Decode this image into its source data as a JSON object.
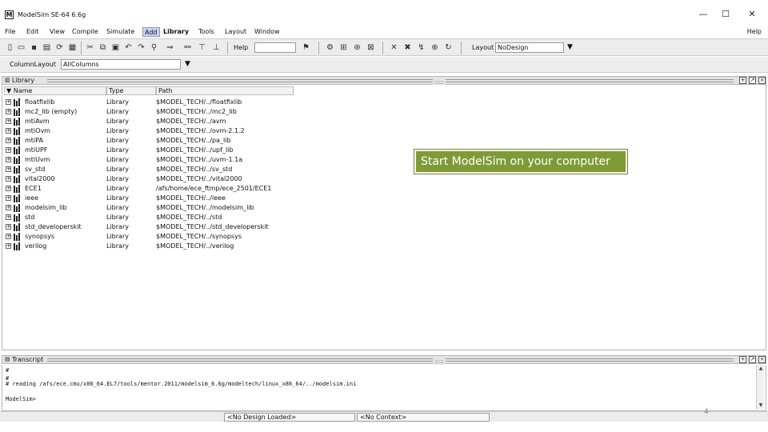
{
  "window": {
    "title": "ModelSim SE-64 6.6g",
    "app_icon": "M",
    "controls": {
      "minimize": "—",
      "maximize": "☐",
      "close": "✕"
    }
  },
  "menu": {
    "items": [
      "File",
      "Edit",
      "View",
      "Compile",
      "Simulate",
      "Add",
      "Library",
      "Tools",
      "Layout",
      "Window"
    ],
    "active": "Library",
    "help": "Help"
  },
  "toolbar": {
    "help_label": "Help",
    "help_value": "",
    "layout_label": "Layout",
    "layout_value": "NoDesign"
  },
  "toolbar2": {
    "column_layout_label": "ColumnLayout",
    "column_layout_value": "AllColumns"
  },
  "library_pane": {
    "title": "Library",
    "columns": {
      "name": "Name",
      "type": "Type",
      "path": "Path"
    },
    "rows": [
      {
        "name": "floatfixlib",
        "type": "Library",
        "path": "$MODEL_TECH/../floatfixlib"
      },
      {
        "name": "mc2_lib (empty)",
        "type": "Library",
        "path": "$MODEL_TECH/../mc2_lib"
      },
      {
        "name": "mtiAvm",
        "type": "Library",
        "path": "$MODEL_TECH/../avm"
      },
      {
        "name": "mtiOvm",
        "type": "Library",
        "path": "$MODEL_TECH/../ovm-2.1.2"
      },
      {
        "name": "mtiPA",
        "type": "Library",
        "path": "$MODEL_TECH/../pa_lib"
      },
      {
        "name": "mtiUPF",
        "type": "Library",
        "path": "$MODEL_TECH/../upf_lib"
      },
      {
        "name": "mtiUvm",
        "type": "Library",
        "path": "$MODEL_TECH/../uvm-1.1a"
      },
      {
        "name": "sv_std",
        "type": "Library",
        "path": "$MODEL_TECH/../sv_std"
      },
      {
        "name": "vital2000",
        "type": "Library",
        "path": "$MODEL_TECH/../vital2000"
      },
      {
        "name": "ECE1",
        "type": "Library",
        "path": "/afs/home/ece_ftmp/ece_2501/ECE1"
      },
      {
        "name": "ieee",
        "type": "Library",
        "path": "$MODEL_TECH/../ieee"
      },
      {
        "name": "modelsim_lib",
        "type": "Library",
        "path": "$MODEL_TECH/../modelsim_lib"
      },
      {
        "name": "std",
        "type": "Library",
        "path": "$MODEL_TECH/../std"
      },
      {
        "name": "std_developerskit",
        "type": "Library",
        "path": "$MODEL_TECH/../std_developerskit"
      },
      {
        "name": "synopsys",
        "type": "Library",
        "path": "$MODEL_TECH/../synopsys"
      },
      {
        "name": "verilog",
        "type": "Library",
        "path": "$MODEL_TECH/../verilog"
      }
    ]
  },
  "callout": "Start ModelSim on your computer",
  "transcript_pane": {
    "title": "Transcript",
    "lines": [
      "#",
      "#",
      "# reading /afs/ece.cmu/x86_64.EL7/tools/mentor.2011/modelsim_6.6g/modeltech/linux_x86_64/../modelsim.ini",
      "",
      "ModelSim>"
    ]
  },
  "statusbar": {
    "design": "<No Design Loaded>",
    "context": "<No Context>"
  },
  "page_number": "4"
}
